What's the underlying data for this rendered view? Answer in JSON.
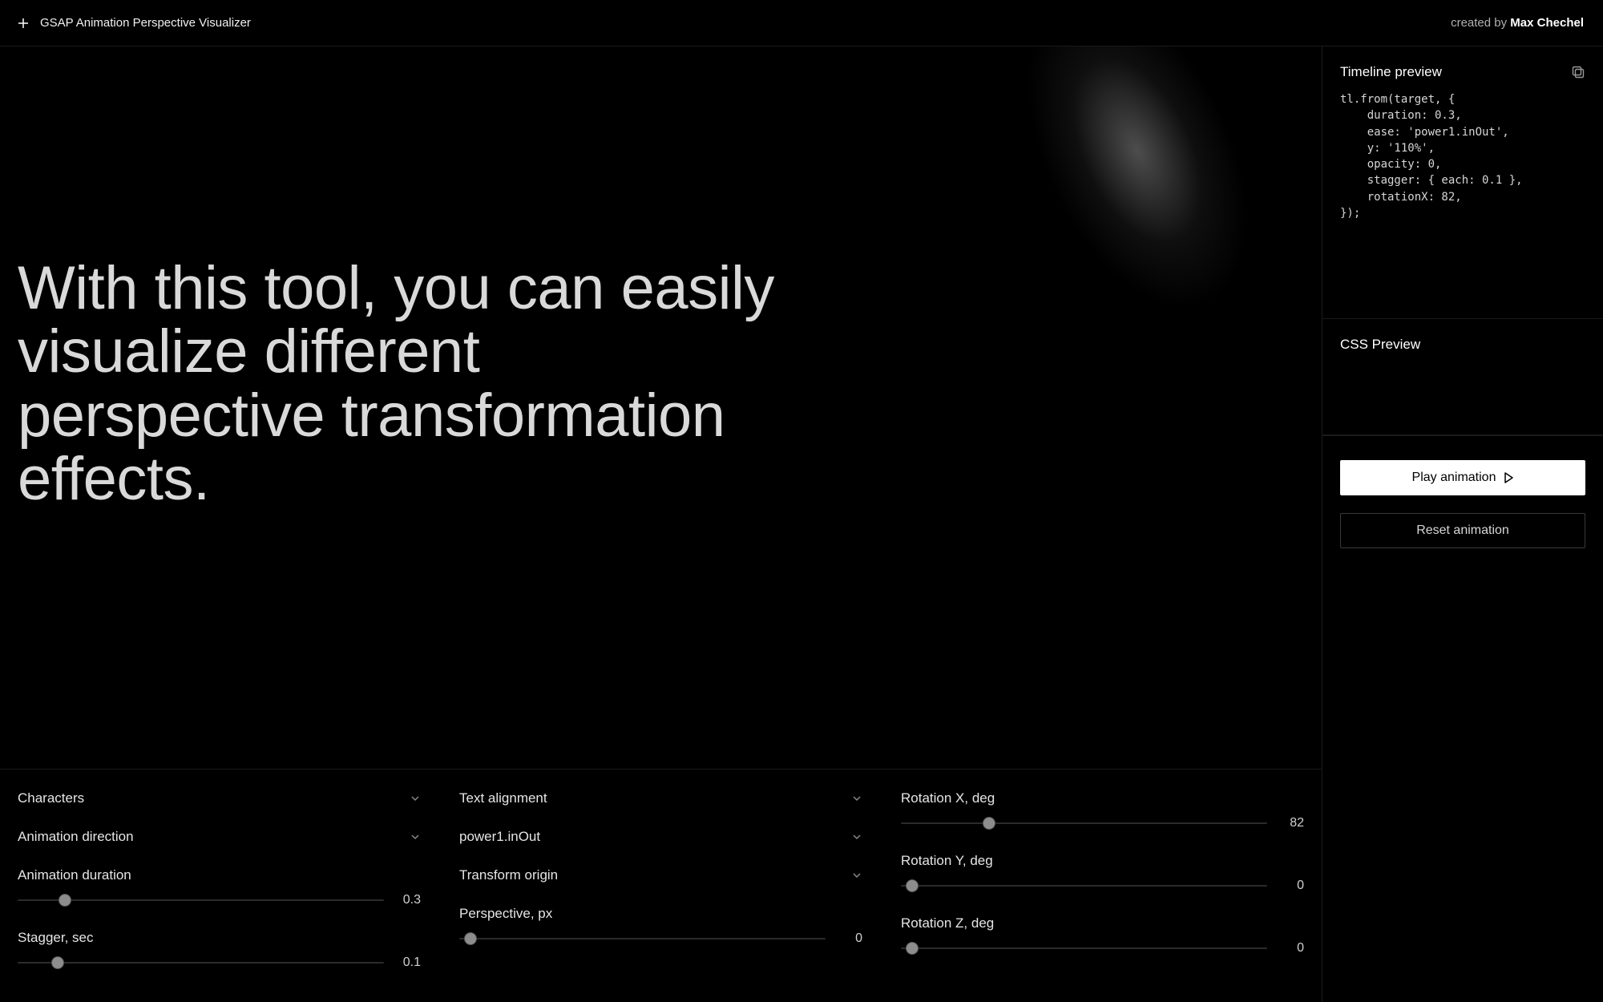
{
  "header": {
    "title": "GSAP Animation Perspective Visualizer",
    "credit_prefix": "created by ",
    "credit_name": "Max Chechel"
  },
  "hero_text": "With this tool, you can easily visualize different perspective transformation effects.",
  "controls": {
    "col1": {
      "characters": {
        "label": "Characters"
      },
      "direction": {
        "label": "Animation direction"
      },
      "duration": {
        "label": "Animation duration",
        "value": "0.3",
        "thumb_pct": 13
      },
      "stagger": {
        "label": "Stagger, sec",
        "value": "0.1",
        "thumb_pct": 11
      }
    },
    "col2": {
      "alignment": {
        "label": "Text alignment"
      },
      "ease": {
        "label": "power1.inOut"
      },
      "origin": {
        "label": "Transform origin"
      },
      "perspective": {
        "label": "Perspective, px",
        "value": "0",
        "thumb_pct": 3
      }
    },
    "col3": {
      "rotx": {
        "label": "Rotation X, deg",
        "value": "82",
        "thumb_pct": 24
      },
      "roty": {
        "label": "Rotation Y, deg",
        "value": "0",
        "thumb_pct": 3
      },
      "rotz": {
        "label": "Rotation Z, deg",
        "value": "0",
        "thumb_pct": 3
      }
    }
  },
  "sidebar": {
    "timeline_heading": "Timeline preview",
    "css_heading": "CSS Preview",
    "code": "tl.from(target, {\n    duration: 0.3,\n    ease: 'power1.inOut',\n    y: '110%',\n    opacity: 0,\n    stagger: { each: 0.1 },\n    rotationX: 82,\n});",
    "play_label": "Play animation",
    "reset_label": "Reset animation"
  }
}
